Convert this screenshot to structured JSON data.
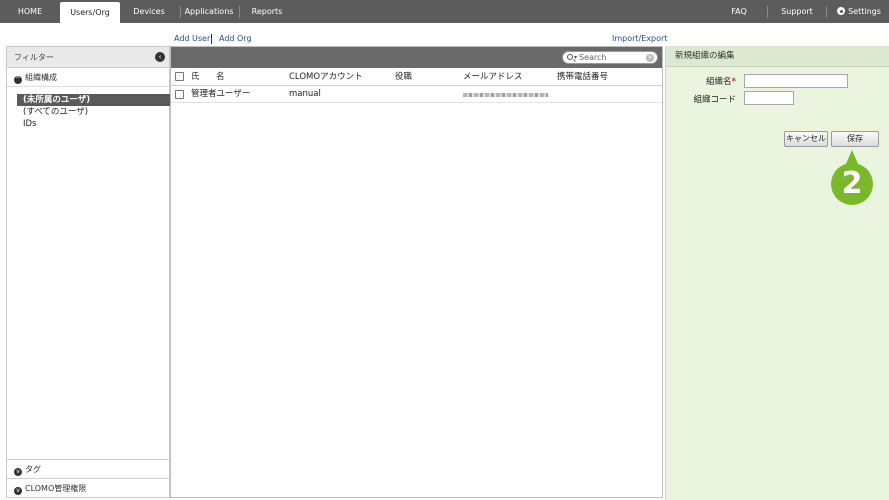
{
  "topnav": {
    "items": [
      {
        "label": "HOME"
      },
      {
        "label": "Users/Org",
        "active": true
      },
      {
        "label": "Devices"
      },
      {
        "label": "Applications"
      },
      {
        "label": "Reports"
      }
    ],
    "right_items": [
      {
        "label": "FAQ"
      },
      {
        "label": "Support"
      },
      {
        "label": "Settings",
        "icon": "gear-icon"
      }
    ]
  },
  "actions": {
    "add_user": "Add User",
    "add_org": "Add Org",
    "import_export": "Import/Export"
  },
  "filter": {
    "title": "フィルター",
    "collapse_icon": "chevron-left-icon",
    "org_section": "組織構成",
    "tree": [
      {
        "label": "(未所属のユーザ)",
        "selected": true
      },
      {
        "label": "(すべてのユーザ)"
      },
      {
        "label": "IDs"
      }
    ],
    "tag_section": "タグ",
    "admin_section": "CLOMO管理権限"
  },
  "search": {
    "placeholder": "Search"
  },
  "table": {
    "columns": [
      "氏",
      "名",
      "CLOMOアカウント",
      "役職",
      "メールアドレス",
      "携帯電話番号"
    ],
    "rows": [
      {
        "name": "管理者ユーザー",
        "account": "manual",
        "title": "",
        "email_obscured": true,
        "phone": ""
      }
    ]
  },
  "org_form": {
    "title": "新規組織の編集",
    "org_name_label": "組織名",
    "required_mark": "*",
    "org_code_label": "組織コード",
    "org_name_value": "",
    "org_code_value": "",
    "cancel_label": "キャンセル",
    "save_label": "保存"
  },
  "callout": {
    "number": "2",
    "color": "#7ab82a"
  },
  "colors": {
    "nav_bg": "#5c5c5c",
    "toolbar_bg": "#6a6a6a",
    "link": "#1f4e8a",
    "right_panel_bg": "#eaf4df",
    "selected_item_bg": "#5a5a5a"
  }
}
